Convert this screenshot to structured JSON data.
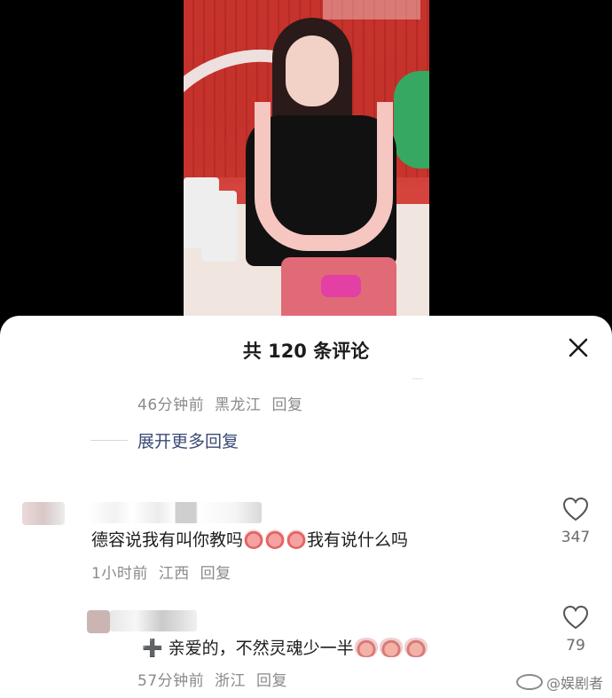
{
  "sheet": {
    "title": "共 120 条评论",
    "close_icon": "close-icon"
  },
  "reply_thread": {
    "meta_time": "46分钟前",
    "meta_location": "黑龙江",
    "meta_reply": "回复",
    "expand_label": "展开更多回复"
  },
  "comments": [
    {
      "text_before": "德容说我有叫你教吗",
      "emojis": 3,
      "text_after": "我有说什么吗",
      "time": "1小时前",
      "location": "江西",
      "reply": "回复",
      "likes": "347"
    },
    {
      "prefix": "➕",
      "text": "亲爱的，不然灵魂少一半",
      "emojis": 3,
      "time": "57分钟前",
      "location": "浙江",
      "reply": "回复",
      "likes": "79"
    }
  ],
  "watermark": "@娱剧者",
  "colors": {
    "accent_link": "#3a4a75",
    "meta_gray": "#8a8a8a",
    "sheet_bg": "#ffffff",
    "backdrop": "#000000"
  }
}
